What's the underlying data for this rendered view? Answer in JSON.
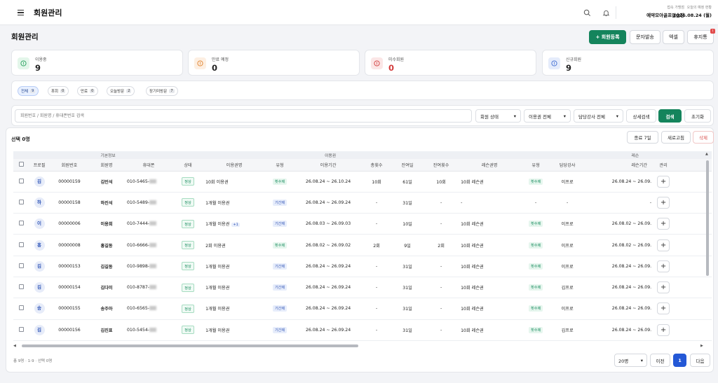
{
  "header": {
    "menu_icon": "hamburger-icon",
    "app_title": "회원관리",
    "search_icon": "search-icon",
    "bell_icon": "bell-icon",
    "center_label": "접속 가맹점",
    "center_name": "예약모아골프연습장",
    "date_label": "오늘의 예정 현황",
    "date_value": "2026.08.24 (월)"
  },
  "page": {
    "title": "회원관리",
    "buttons": {
      "register": "+ 회원등록",
      "sms": "문자발송",
      "excel": "엑셀",
      "trash": "휴지통",
      "trash_badge": "!"
    }
  },
  "stats": [
    {
      "label": "이용중",
      "value": "9",
      "color": "#22a05a",
      "bg": "#e3f6ea",
      "icon": "info-circle-icon"
    },
    {
      "label": "만료 예정",
      "value": "0",
      "color": "#e0812b",
      "bg": "#fdefe2",
      "icon": "info-circle-icon"
    },
    {
      "label": "미수회원",
      "value": "0",
      "color": "#d23b3b",
      "bg": "#fbe6e6",
      "icon": "info-circle-icon",
      "value_color": "#d23b3b"
    },
    {
      "label": "신규회원",
      "value": "9",
      "color": "#3e6bd1",
      "bg": "#e5ecfb",
      "icon": "info-circle-icon"
    }
  ],
  "chips": [
    {
      "label": "전체",
      "count": "9"
    },
    {
      "label": "휴회",
      "count": "0"
    },
    {
      "label": "만료",
      "count": "0"
    },
    {
      "label": "오늘방문",
      "count": "2"
    },
    {
      "label": "장기미방문",
      "count": "7"
    }
  ],
  "filter": {
    "search_placeholder": "회원번호 / 회원명 / 휴대폰번호 검색",
    "status_select": "회원 상태",
    "pass_select": "이용권 전체",
    "coach_select": "담당강사 전체",
    "advanced": "상세검색",
    "search": "검색",
    "reset": "초기화"
  },
  "list": {
    "selected": "선택 0명",
    "expire_btn": "종료 7일",
    "refresh_btn": "새로고침",
    "delete_btn": "삭제"
  },
  "table": {
    "groups": {
      "basic": "기본정보",
      "pass": "이용권",
      "lesson": "레슨"
    },
    "columns": [
      "프로필",
      "회원번호",
      "회원명",
      "휴대폰",
      "상태",
      "이용권명",
      "유형",
      "이용기간",
      "총횟수",
      "잔여일",
      "잔여횟수",
      "레슨권명",
      "유형",
      "담당강사",
      "레슨기간",
      "관리"
    ],
    "rows": [
      {
        "initial": "김",
        "no": "00000159",
        "name": "김민석",
        "phone": "010-5465-",
        "status": "정상",
        "pass": "10회 이용권",
        "extra": "",
        "ptype": "횟수제",
        "ptc": "g",
        "period": "26.08.24 ~ 26.10.24",
        "total": "10회",
        "rdays": "61일",
        "rcount": "10회",
        "lesson": "10회 레슨권",
        "ltype": "횟수제",
        "coach": "이프로",
        "lperiod": "26.08.24 ~ 26.09."
      },
      {
        "initial": "하",
        "no": "00000158",
        "name": "하진석",
        "phone": "010-5489-",
        "status": "정상",
        "pass": "1개월 이용권",
        "extra": "",
        "ptype": "기간제",
        "ptc": "b",
        "period": "26.08.24 ~ 26.09.24",
        "total": "-",
        "rdays": "31일",
        "rcount": "-",
        "lesson": "-",
        "ltype": "-",
        "coach": "-",
        "lperiod": "-"
      },
      {
        "initial": "이",
        "no": "00000006",
        "name": "이용희",
        "phone": "010-7444-",
        "status": "정상",
        "pass": "1개월 이용권",
        "extra": "+1",
        "ptype": "기간제",
        "ptc": "b",
        "period": "26.08.03 ~ 26.09.03",
        "total": "-",
        "rdays": "10일",
        "rcount": "-",
        "lesson": "10회 레슨권",
        "ltype": "횟수제",
        "coach": "이프로",
        "lperiod": "26.08.02 ~ 26.09."
      },
      {
        "initial": "홍",
        "no": "00000008",
        "name": "홍길동",
        "phone": "010-6666-",
        "status": "정상",
        "pass": "2회 이용권",
        "extra": "",
        "ptype": "횟수제",
        "ptc": "g",
        "period": "26.08.02 ~ 26.09.02",
        "total": "2회",
        "rdays": "9일",
        "rcount": "2회",
        "lesson": "10회 레슨권",
        "ltype": "횟수제",
        "coach": "이프로",
        "lperiod": "26.08.02 ~ 26.09."
      },
      {
        "initial": "김",
        "no": "00000153",
        "name": "김길동",
        "phone": "010-9898-",
        "status": "정상",
        "pass": "1개월 이용권",
        "extra": "",
        "ptype": "기간제",
        "ptc": "b",
        "period": "26.08.24 ~ 26.09.24",
        "total": "-",
        "rdays": "31일",
        "rcount": "-",
        "lesson": "10회 레슨권",
        "ltype": "횟수제",
        "coach": "이프로",
        "lperiod": "26.08.24 ~ 26.09."
      },
      {
        "initial": "김",
        "no": "00000154",
        "name": "김다미",
        "phone": "010-8787-",
        "status": "정상",
        "pass": "1개월 이용권",
        "extra": "",
        "ptype": "기간제",
        "ptc": "b",
        "period": "26.08.24 ~ 26.09.24",
        "total": "-",
        "rdays": "31일",
        "rcount": "-",
        "lesson": "10회 레슨권",
        "ltype": "횟수제",
        "coach": "김프로",
        "lperiod": "26.08.24 ~ 26.09."
      },
      {
        "initial": "송",
        "no": "00000155",
        "name": "송주아",
        "phone": "010-6565-",
        "status": "정상",
        "pass": "1개월 이용권",
        "extra": "",
        "ptype": "기간제",
        "ptc": "b",
        "period": "26.08.24 ~ 26.09.24",
        "total": "-",
        "rdays": "31일",
        "rcount": "-",
        "lesson": "10회 레슨권",
        "ltype": "횟수제",
        "coach": "이프로",
        "lperiod": "26.08.24 ~ 26.09."
      },
      {
        "initial": "김",
        "no": "00000156",
        "name": "김진표",
        "phone": "010-5454-",
        "status": "정상",
        "pass": "1개월 이용권",
        "extra": "",
        "ptype": "기간제",
        "ptc": "b",
        "period": "26.08.24 ~ 26.09.24",
        "total": "-",
        "rdays": "31일",
        "rcount": "-",
        "lesson": "10회 레슨권",
        "ltype": "횟수제",
        "coach": "김프로",
        "lperiod": "26.08.24 ~ 26.09."
      }
    ]
  },
  "footer": {
    "summary": "총 9명 · 1-9 · 선택 0명",
    "page_size": "20명",
    "prev": "이전",
    "current": "1",
    "next": "다음"
  }
}
